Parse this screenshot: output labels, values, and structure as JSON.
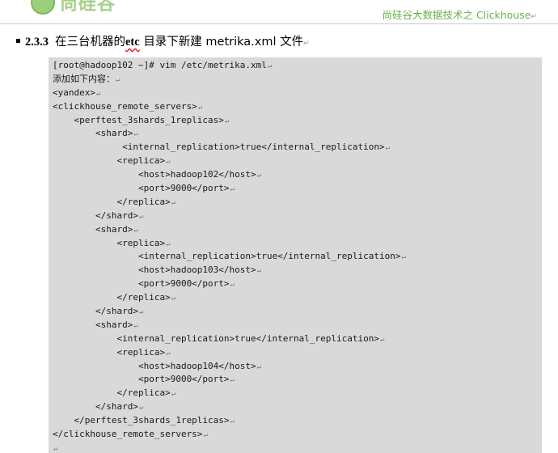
{
  "header": {
    "logo_text": "尚硅谷",
    "title": "尚硅谷大数据技术之 Clickhouse",
    "title_mark": "↵"
  },
  "section": {
    "number": "2.3.3",
    "text_before": "在三台机器的",
    "keyword": "etc",
    "text_after": "目录下新建 metrika.xml 文件",
    "mark": "↵"
  },
  "code": {
    "para_mark": "↵",
    "lines": [
      "[root@hadoop102 ~]# vim /etc/metrika.xml",
      "添加如下内容：",
      "<yandex>",
      "<clickhouse_remote_servers>",
      "    <perftest_3shards_1replicas>",
      "        <shard>",
      "             <internal_replication>true</internal_replication>",
      "            <replica>",
      "                <host>hadoop102</host>",
      "                <port>9000</port>",
      "            </replica>",
      "        </shard>",
      "        <shard>",
      "            <replica>",
      "                <internal_replication>true</internal_replication>",
      "                <host>hadoop103</host>",
      "                <port>9000</port>",
      "            </replica>",
      "        </shard>",
      "        <shard>",
      "            <internal_replication>true</internal_replication>",
      "            <replica>",
      "                <host>hadoop104</host>",
      "                <port>9000</port>",
      "            </replica>",
      "        </shard>",
      "    </perftest_3shards_1replicas>",
      "</clickhouse_remote_servers>",
      ""
    ]
  }
}
